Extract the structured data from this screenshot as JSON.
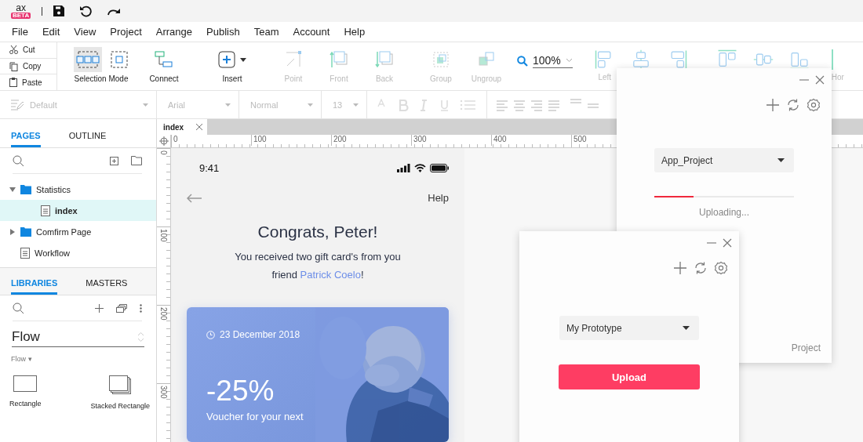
{
  "title_bar": {
    "logo": "ax",
    "badge": "BETA"
  },
  "menu": [
    "File",
    "Edit",
    "View",
    "Project",
    "Arrange",
    "Publish",
    "Team",
    "Account",
    "Help"
  ],
  "clipboard": [
    "Cut",
    "Copy",
    "Paste"
  ],
  "tools": [
    {
      "label": "Selection Mode",
      "kind": "selection",
      "disabled": false
    },
    {
      "label": "Connect",
      "kind": "connect",
      "disabled": false
    },
    {
      "label": "Insert",
      "kind": "insert",
      "disabled": false
    },
    {
      "label": "Point",
      "kind": "point",
      "disabled": true
    },
    {
      "label": "Front",
      "kind": "front",
      "disabled": true
    },
    {
      "label": "Back",
      "kind": "back",
      "disabled": true
    },
    {
      "label": "Group",
      "kind": "group",
      "disabled": true
    },
    {
      "label": "Ungroup",
      "kind": "ungroup",
      "disabled": true
    }
  ],
  "zoom": {
    "value": "100%"
  },
  "align_tools": [
    {
      "kind": "left",
      "label": "Left"
    },
    {
      "kind": "center"
    },
    {
      "kind": "right"
    },
    {
      "kind": "top"
    },
    {
      "kind": "middle"
    },
    {
      "kind": "bottom"
    },
    {
      "kind": "horizontal",
      "label": "Hor"
    }
  ],
  "format_bar": {
    "style": "Default",
    "font": "Arial",
    "weight": "Normal",
    "size": "13",
    "disabled": true
  },
  "pages_panel": {
    "tabs": [
      {
        "label": "PAGES",
        "selected": true
      },
      {
        "label": "OUTLINE",
        "selected": false
      }
    ],
    "pages": [
      {
        "name": "Statistics",
        "kind": "folder",
        "expanded": true,
        "selected": false,
        "children": [
          {
            "name": "index",
            "kind": "page",
            "selected": true
          }
        ]
      },
      {
        "name": "Comfirm Page",
        "kind": "folder",
        "expanded": false,
        "selected": false
      },
      {
        "name": "Workflow",
        "kind": "page",
        "selected": false
      }
    ]
  },
  "libraries_panel": {
    "tabs": [
      {
        "label": "LIBRARIES",
        "selected": true
      },
      {
        "label": "MASTERS",
        "selected": false
      }
    ],
    "library": "Flow",
    "group": "Flow ▾",
    "widgets": [
      {
        "label": "Rectangle",
        "kind": "rectangle"
      },
      {
        "label": "Stacked Rectangle",
        "kind": "stacked"
      }
    ]
  },
  "document_tabs": [
    {
      "label": "index",
      "selected": true
    }
  ],
  "ruler": {
    "horizontal": [
      "0",
      "100",
      "200",
      "300",
      "400",
      "500"
    ],
    "vertical": [
      "0",
      "100",
      "200",
      "300"
    ]
  },
  "screen": {
    "time": "9:41",
    "nav_action": "Help",
    "heading": "Congrats, Peter!",
    "message": "You received two gift card's from you friend",
    "friend": "Patrick Coelo",
    "message_end": "!",
    "voucher": {
      "date": "23 December 2018",
      "discount": "-25%",
      "description": "Voucher for your next"
    }
  },
  "upload_windows": [
    {
      "kind": "progress",
      "project": "App_Project",
      "level": 0.28,
      "status": "Uploading...",
      "footer": "Project"
    },
    {
      "kind": "ready",
      "project": "My Prototype",
      "button": "Upload"
    }
  ]
}
